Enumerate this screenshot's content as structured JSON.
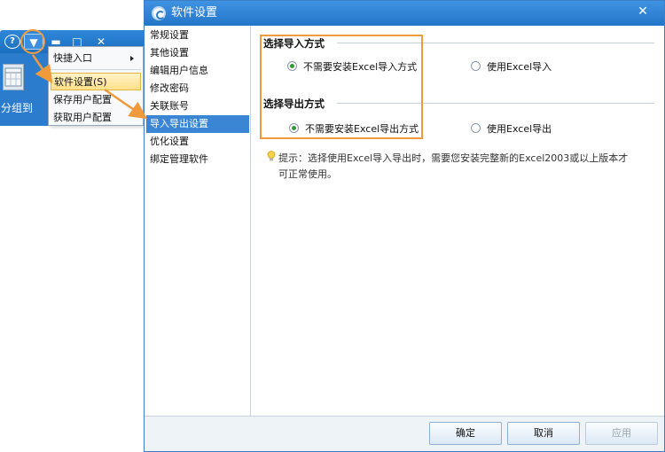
{
  "background_app": {
    "help_glyph": "?",
    "dropdown_glyph": "▼",
    "minimize_glyph": "▬",
    "maximize_glyph": "□",
    "close_glyph": "✕",
    "partial_label": "分组到",
    "icons": [
      "help-icon",
      "dropdown-arrow-icon",
      "minimize-icon",
      "maximize-icon",
      "close-icon",
      "calendar-icon"
    ]
  },
  "context_menu": {
    "items": [
      {
        "label": "快捷入口",
        "has_submenu": true
      },
      {
        "label": "软件设置(S)",
        "highlighted": true
      },
      {
        "label": "保存用户配置"
      },
      {
        "label": "获取用户配置"
      }
    ]
  },
  "dialog": {
    "title": "软件设置",
    "close_glyph": "✕",
    "nav": [
      {
        "label": "常规设置"
      },
      {
        "label": "其他设置"
      },
      {
        "label": "编辑用户信息"
      },
      {
        "label": "修改密码"
      },
      {
        "label": "关联账号"
      },
      {
        "label": "导入导出设置",
        "active": true
      },
      {
        "label": "优化设置"
      },
      {
        "label": "绑定管理软件"
      }
    ],
    "import_section": {
      "title": "选择导入方式",
      "options": [
        {
          "label": "不需要安装Excel导入方式",
          "selected": true
        },
        {
          "label": "使用Excel导入",
          "selected": false
        }
      ]
    },
    "export_section": {
      "title": "选择导出方式",
      "options": [
        {
          "label": "不需要安装Excel导出方式",
          "selected": true
        },
        {
          "label": "使用Excel导出",
          "selected": false
        }
      ]
    },
    "tip": "提示：选择使用Excel导入导出时，需要您安装完整新的Excel2003或以上版本才可正常使用。",
    "buttons": {
      "ok": "确定",
      "cancel": "取消",
      "apply": "应用"
    }
  },
  "colors": {
    "title_blue": "#2476c8",
    "active_nav": "#3a86d4",
    "highlight_orange": "#f09a3e",
    "radio_selected": "#2f9a3a"
  }
}
